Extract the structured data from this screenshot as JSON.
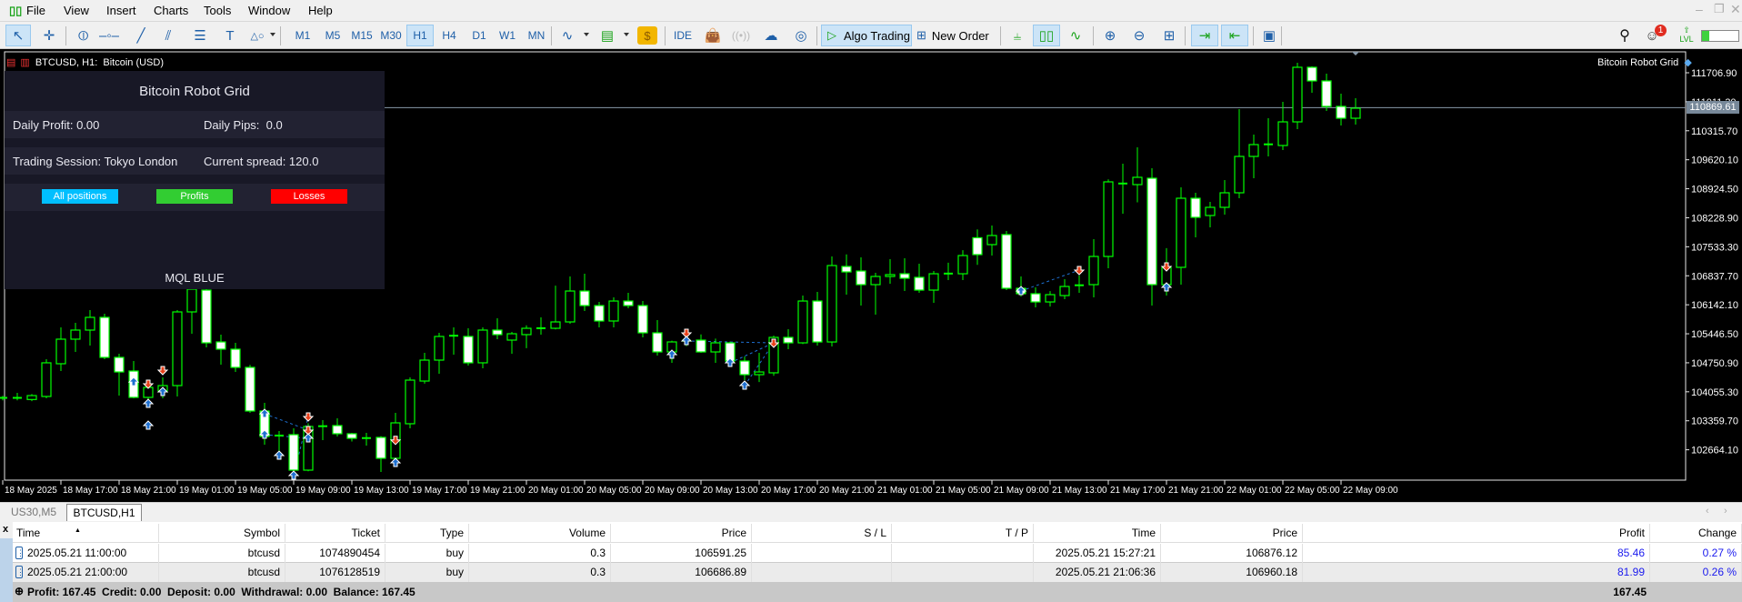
{
  "menu": [
    "File",
    "View",
    "Insert",
    "Charts",
    "Tools",
    "Window",
    "Help"
  ],
  "toolbar": {
    "timeframes": [
      "M1",
      "M5",
      "M15",
      "M30",
      "H1",
      "H4",
      "D1",
      "W1",
      "MN"
    ],
    "selected_timeframe": "H1",
    "ide_label": "IDE",
    "algo_trading_label": "Algo Trading",
    "new_order_label": "New Order",
    "notification_count": "1",
    "level_label": "LVL",
    "level_progress": 0.2
  },
  "chart": {
    "header": "BTCUSD, H1:  Bitcoin (USD)",
    "ea_name": "Bitcoin Robot Grid",
    "current_price": "110869.61",
    "price_labels": [
      "111706.90",
      "111011.30",
      "110315.70",
      "109620.10",
      "108924.50",
      "108228.90",
      "107533.30",
      "106837.70",
      "106142.10",
      "105446.50",
      "104750.90",
      "104055.30",
      "103359.70",
      "102664.10"
    ],
    "time_labels": [
      "18 May 2025",
      "18 May 17:00",
      "18 May 21:00",
      "19 May 01:00",
      "19 May 05:00",
      "19 May 09:00",
      "19 May 13:00",
      "19 May 17:00",
      "19 May 21:00",
      "20 May 01:00",
      "20 May 05:00",
      "20 May 09:00",
      "20 May 13:00",
      "20 May 17:00",
      "20 May 21:00",
      "21 May 01:00",
      "21 May 05:00",
      "21 May 09:00",
      "21 May 13:00",
      "21 May 17:00",
      "21 May 21:00",
      "22 May 01:00",
      "22 May 05:00",
      "22 May 09:00"
    ]
  },
  "panel": {
    "title": "Bitcoin Robot Grid",
    "daily_profit": "Daily Profit: 0.00",
    "daily_pips": "Daily Pips:  0.0",
    "session": "Trading Session: Tokyo London",
    "spread": "Current spread: 120.0",
    "btn_all": "All positions",
    "btn_profits": "Profits",
    "btn_losses": "Losses",
    "footer": "MQL BLUE",
    "colors": {
      "all": "#00bfff",
      "profits": "#32cd32",
      "losses": "#ff0000"
    }
  },
  "tabs": [
    "US30,M5",
    "BTCUSD,H1"
  ],
  "table": {
    "headers": [
      "Time",
      "Symbol",
      "Ticket",
      "Type",
      "Volume",
      "Price",
      "S / L",
      "T / P",
      "Time",
      "Price",
      "Profit",
      "Change"
    ],
    "rows": [
      [
        "2025.05.21 11:00:00",
        "btcusd",
        "1074890454",
        "buy",
        "0.3",
        "106591.25",
        "",
        "",
        "2025.05.21 15:27:21",
        "106876.12",
        "85.46",
        "0.27 %"
      ],
      [
        "2025.05.21 21:00:00",
        "btcusd",
        "1076128519",
        "buy",
        "0.3",
        "106686.89",
        "",
        "",
        "2025.05.21 21:06:36",
        "106960.18",
        "81.99",
        "0.26 %"
      ]
    ],
    "summary": "Profit: 167.45  Credit: 0.00  Deposit: 0.00  Withdrawal: 0.00  Balance: 167.45",
    "summary_total": "167.45"
  },
  "chart_data": {
    "type": "candlestick",
    "symbol": "BTCUSD",
    "timeframe": "H1",
    "start": "18 May 2025 13:00",
    "interval_hours": 1,
    "ylim": [
      102200,
      112200
    ],
    "ohlc": [
      [
        103900,
        103960,
        103850,
        103910
      ],
      [
        103910,
        104030,
        103850,
        103905
      ],
      [
        103870,
        104000,
        103830,
        103964
      ],
      [
        103943,
        104837,
        103900,
        104750
      ],
      [
        104728,
        105600,
        104553,
        105317
      ],
      [
        105317,
        105710,
        105011,
        105535
      ],
      [
        105535,
        106015,
        105164,
        105840
      ],
      [
        105840,
        105928,
        104837,
        104880
      ],
      [
        104880,
        104967,
        103964,
        104531
      ],
      [
        104553,
        104793,
        103900,
        103921
      ],
      [
        103921,
        104250,
        103700,
        104160
      ],
      [
        104073,
        104400,
        103900,
        104204
      ],
      [
        104204,
        106015,
        103943,
        105971
      ],
      [
        105971,
        106560,
        105447,
        106516
      ],
      [
        106494,
        106516,
        105120,
        105229
      ],
      [
        105251,
        105426,
        104706,
        105077
      ],
      [
        105077,
        105229,
        104531,
        104640
      ],
      [
        104640,
        104700,
        103550,
        103594
      ],
      [
        103594,
        103790,
        102786,
        102983
      ],
      [
        102990,
        103114,
        102612,
        103005
      ],
      [
        103027,
        103180,
        102100,
        102176
      ],
      [
        102176,
        103300,
        102150,
        103223
      ],
      [
        103200,
        103376,
        102895,
        103230
      ],
      [
        103245,
        103420,
        102983,
        103049
      ],
      [
        103049,
        103070,
        102862,
        102939
      ],
      [
        102930,
        103070,
        102764,
        102945
      ],
      [
        102961,
        102990,
        102132,
        102460
      ],
      [
        102460,
        103550,
        102400,
        103310
      ],
      [
        103289,
        104400,
        103180,
        104335
      ],
      [
        104313,
        104990,
        104250,
        104815
      ],
      [
        104815,
        105470,
        104488,
        105382
      ],
      [
        105382,
        105600,
        104946,
        105400
      ],
      [
        105382,
        105578,
        104685,
        104750
      ],
      [
        104750,
        105600,
        104620,
        105535
      ],
      [
        105535,
        105818,
        105317,
        105426
      ],
      [
        105295,
        105490,
        104968,
        105447
      ],
      [
        105426,
        105650,
        105100,
        105578
      ],
      [
        105570,
        105840,
        105426,
        105580
      ],
      [
        105578,
        106600,
        105550,
        105731
      ],
      [
        105731,
        106821,
        105687,
        106472
      ],
      [
        106472,
        106886,
        105993,
        106123
      ],
      [
        106123,
        106210,
        105600,
        105753
      ],
      [
        105753,
        106320,
        105600,
        106232
      ],
      [
        106232,
        106429,
        106058,
        106123
      ],
      [
        106123,
        106232,
        105360,
        105469
      ],
      [
        105469,
        105775,
        104924,
        105011
      ],
      [
        105011,
        105280,
        104750,
        105251
      ],
      [
        105251,
        105300,
        105150,
        105280
      ],
      [
        105295,
        105430,
        104990,
        105011
      ],
      [
        105011,
        105330,
        104750,
        105229
      ],
      [
        105229,
        105260,
        104700,
        104793
      ],
      [
        104793,
        104900,
        104335,
        104466
      ],
      [
        104466,
        104990,
        104290,
        104531
      ],
      [
        104510,
        105400,
        104440,
        105360
      ],
      [
        105360,
        105557,
        105077,
        105229
      ],
      [
        105229,
        106363,
        105200,
        106232
      ],
      [
        106232,
        106450,
        105164,
        105250
      ],
      [
        105250,
        107300,
        105142,
        107083
      ],
      [
        107061,
        107350,
        106385,
        106930
      ],
      [
        106952,
        107280,
        106123,
        106625
      ],
      [
        106625,
        106910,
        105905,
        106821
      ],
      [
        106821,
        107236,
        106647,
        106865
      ],
      [
        106886,
        107257,
        106472,
        106777
      ],
      [
        106800,
        107127,
        106429,
        106494
      ],
      [
        106494,
        106952,
        106188,
        106886
      ],
      [
        106880,
        107150,
        106734,
        106890
      ],
      [
        106886,
        107450,
        106734,
        107323
      ],
      [
        107750,
        107950,
        107100,
        107345
      ],
      [
        107585,
        108043,
        107323,
        107803
      ],
      [
        107825,
        107912,
        106494,
        106538
      ],
      [
        106538,
        106821,
        106340,
        106407
      ],
      [
        106407,
        106560,
        106080,
        106210
      ],
      [
        106210,
        106470,
        106100,
        106385
      ],
      [
        106363,
        106756,
        106276,
        106581
      ],
      [
        106581,
        106843,
        106429,
        106610
      ],
      [
        106625,
        107715,
        106320,
        107301
      ],
      [
        107301,
        109150,
        107017,
        109090
      ],
      [
        109040,
        109526,
        108326,
        109050
      ],
      [
        109024,
        109918,
        108600,
        109199
      ],
      [
        109177,
        109417,
        106123,
        106625
      ],
      [
        106625,
        107500,
        106363,
        107040
      ],
      [
        107040,
        108960,
        106625,
        108697
      ],
      [
        108697,
        108828,
        107760,
        108239
      ],
      [
        108283,
        108610,
        108000,
        108479
      ],
      [
        108479,
        109133,
        108304,
        108828
      ],
      [
        108828,
        110834,
        108697,
        109700
      ],
      [
        109700,
        110224,
        109177,
        109984
      ],
      [
        109980,
        110616,
        109700,
        109990
      ],
      [
        109962,
        111009,
        109853,
        110529
      ],
      [
        110529,
        111947,
        110355,
        111838
      ],
      [
        111838,
        111860,
        111227,
        111511
      ],
      [
        111511,
        111685,
        110791,
        110900
      ],
      [
        110900,
        111205,
        110442,
        110616
      ],
      [
        110616,
        111096,
        110464,
        110856
      ]
    ],
    "trade_markers": [
      {
        "i": 9,
        "price": 104290,
        "side": "buy"
      },
      {
        "i": 10,
        "price": 104247,
        "side": "sell"
      },
      {
        "i": 10,
        "price": 103768,
        "side": "buy"
      },
      {
        "i": 10,
        "price": 103245,
        "side": "buy"
      },
      {
        "i": 11,
        "price": 104575,
        "side": "sell"
      },
      {
        "i": 11,
        "price": 104051,
        "side": "buy"
      },
      {
        "i": 18,
        "price": 103528,
        "side": "buy"
      },
      {
        "i": 18,
        "price": 103027,
        "side": "buy"
      },
      {
        "i": 19,
        "price": 102524,
        "side": "buy"
      },
      {
        "i": 20,
        "price": 102045,
        "side": "buy"
      },
      {
        "i": 21,
        "price": 103462,
        "side": "sell"
      },
      {
        "i": 21,
        "price": 103136,
        "side": "sell"
      },
      {
        "i": 21,
        "price": 102939,
        "side": "buy"
      },
      {
        "i": 27,
        "price": 102900,
        "side": "sell"
      },
      {
        "i": 27,
        "price": 102350,
        "side": "buy"
      },
      {
        "i": 46,
        "price": 104946,
        "side": "buy"
      },
      {
        "i": 47,
        "price": 105469,
        "side": "sell"
      },
      {
        "i": 47,
        "price": 105273,
        "side": "buy"
      },
      {
        "i": 50,
        "price": 104750,
        "side": "buy"
      },
      {
        "i": 51,
        "price": 104204,
        "side": "buy"
      },
      {
        "i": 53,
        "price": 105229,
        "side": "sell"
      },
      {
        "i": 70,
        "price": 106472,
        "side": "buy"
      },
      {
        "i": 74,
        "price": 106974,
        "side": "sell"
      },
      {
        "i": 80,
        "price": 107061,
        "side": "sell"
      },
      {
        "i": 80,
        "price": 106560,
        "side": "buy"
      }
    ],
    "trade_lines": [
      [
        18,
        103528,
        21,
        103136
      ],
      [
        18,
        103027,
        21,
        102939
      ],
      [
        20,
        102045,
        21,
        103462
      ],
      [
        27,
        102350,
        27,
        102900
      ],
      [
        47,
        105273,
        53,
        105229
      ],
      [
        50,
        104750,
        53,
        105229
      ],
      [
        51,
        104204,
        53,
        105229
      ],
      [
        70,
        106472,
        74,
        106974
      ],
      [
        80,
        106560,
        80,
        107061
      ]
    ],
    "colors": {
      "up": "#00ff00",
      "down_fill": "#ffffff",
      "buy": "#1e6fd0",
      "sell": "#e8401a",
      "price_line": "#8899aa"
    }
  }
}
